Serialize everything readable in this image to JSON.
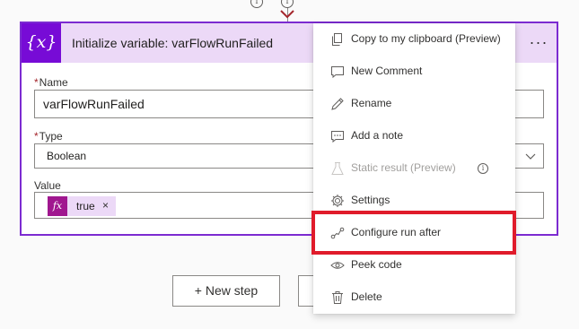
{
  "card": {
    "icon_label": "{x}",
    "title": "Initialize variable: varFlowRunFailed",
    "more_label": "···"
  },
  "fields": {
    "name": {
      "label": "Name",
      "required_mark": "*",
      "value": "varFlowRunFailed"
    },
    "type": {
      "label": "Type",
      "required_mark": "*",
      "value": "Boolean"
    },
    "value": {
      "label": "Value",
      "token_icon": "fx",
      "token_text": "true",
      "token_remove": "×"
    }
  },
  "buttons": {
    "new_step": "+ New step"
  },
  "top_info": {
    "glyph": "i"
  },
  "menu": {
    "items": [
      {
        "label": "Copy to my clipboard (Preview)",
        "icon": "copy-icon",
        "disabled": false
      },
      {
        "label": "New Comment",
        "icon": "comment-icon",
        "disabled": false
      },
      {
        "label": "Rename",
        "icon": "pencil-icon",
        "disabled": false
      },
      {
        "label": "Add a note",
        "icon": "note-icon",
        "disabled": false
      },
      {
        "label": "Static result (Preview)",
        "icon": "flask-icon",
        "disabled": true,
        "info": "i"
      },
      {
        "label": "Settings",
        "icon": "gear-icon",
        "disabled": false
      },
      {
        "label": "Configure run after",
        "icon": "run-after-icon",
        "disabled": false,
        "highlighted": true
      },
      {
        "label": "Peek code",
        "icon": "eye-icon",
        "disabled": false
      },
      {
        "label": "Delete",
        "icon": "trash-icon",
        "disabled": false
      }
    ]
  },
  "colors": {
    "accent": "#770bd6",
    "card_border": "#7c2bd1",
    "header_bg": "#ecd9f7",
    "highlight": "#e01b2b",
    "fx_token": "#a0178f"
  }
}
